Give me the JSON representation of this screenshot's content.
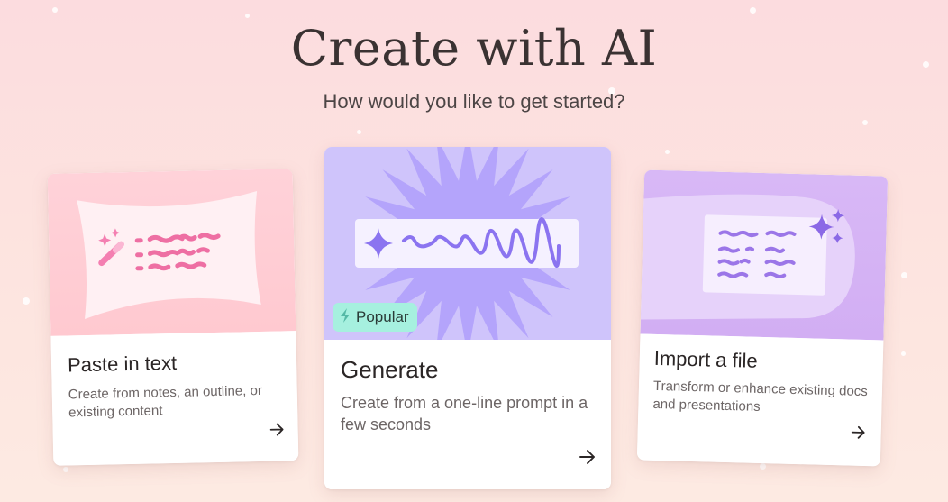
{
  "header": {
    "title": "Create with AI",
    "subtitle": "How would you like to get started?"
  },
  "cards": [
    {
      "id": "paste",
      "title": "Paste in text",
      "description": "Create from notes, an outline, or existing content",
      "arrow_icon": "arrow-right-icon",
      "art_icon": "magic-wand-icon",
      "accent": "#ffc9d0"
    },
    {
      "id": "generate",
      "title": "Generate",
      "description": "Create from a one-line prompt in a few seconds",
      "badge": "Popular",
      "badge_icon": "lightning-icon",
      "badge_color": "#a6f0df",
      "arrow_icon": "arrow-right-icon",
      "art_icon": "sparkle-icon",
      "accent": "#b5a6fb"
    },
    {
      "id": "import",
      "title": "Import a file",
      "description": "Transform or enhance existing docs and presentations",
      "arrow_icon": "arrow-right-icon",
      "art_icon": "sparkles-icon",
      "accent": "#d2aef3"
    }
  ],
  "colors": {
    "background": "#fde2e0",
    "title_text": "#3a3232",
    "card_text": "#2b2626"
  }
}
